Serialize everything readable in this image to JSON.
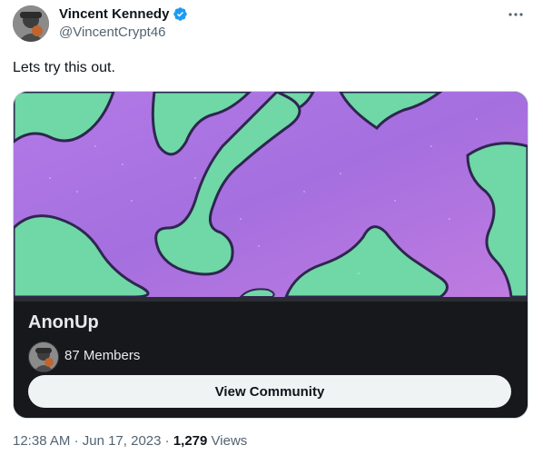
{
  "author": {
    "name": "Vincent Kennedy",
    "handle": "@VincentCrypt46",
    "verified": true
  },
  "post": {
    "text": "Lets try this out."
  },
  "community": {
    "name": "AnonUp",
    "members": "87 Members",
    "button_label": "View Community"
  },
  "meta": {
    "time": "12:38 AM",
    "separator": "·",
    "date": "Jun 17, 2023",
    "views_count": "1,279",
    "views_label": "Views"
  },
  "colors": {
    "verified": "#1d9bf0",
    "banner_purple": "#b67de3",
    "banner_green": "#6fd8a6",
    "card_dark": "#16181c"
  },
  "icons": {
    "verified": "verified-badge-icon",
    "more": "more-icon"
  }
}
